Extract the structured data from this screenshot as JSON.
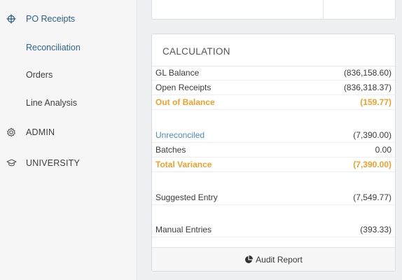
{
  "sidebar": {
    "po_receipts": "PO Receipts",
    "sub_items": [
      "Reconciliation",
      "Orders",
      "Line Analysis"
    ],
    "admin": "ADMIN",
    "university": "UNIVERSITY"
  },
  "calculation": {
    "title": "CALCULATION",
    "rows": [
      {
        "label": "GL Balance",
        "value": "(836,158.60)"
      },
      {
        "label": "Open Receipts",
        "value": "(836,318.37)"
      },
      {
        "label": "Out of Balance",
        "value": "(159.77)"
      },
      {
        "label": "Unreconciled",
        "value": "(7,390.00)"
      },
      {
        "label": "Batches",
        "value": "0.00"
      },
      {
        "label": "Total Variance",
        "value": "(7,390.00)"
      },
      {
        "label": "Suggested Entry",
        "value": "(7,549.77)"
      },
      {
        "label": "Manual Entries",
        "value": "(393.33)"
      }
    ],
    "footer_button": "Audit Report"
  },
  "colors": {
    "accent_blue": "#2f6590",
    "link_blue": "#4a8bc2",
    "warning_orange": "#f0a02b"
  }
}
